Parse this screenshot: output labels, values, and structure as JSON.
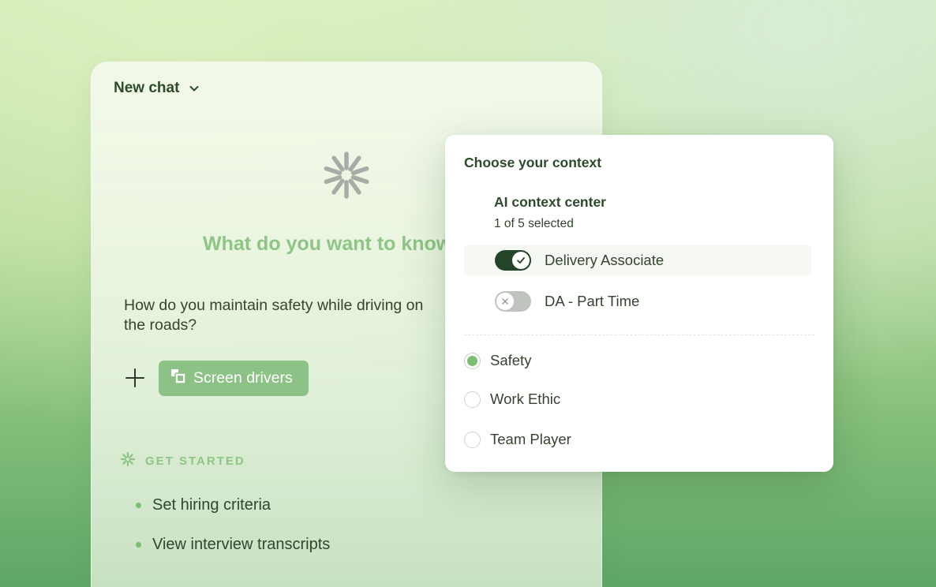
{
  "chat": {
    "title": "New chat",
    "heading": "What do you want to know",
    "question": "How do you maintain safety while driving on the roads?",
    "screen_button_label": "Screen drivers",
    "get_started_label": "GET STARTED",
    "suggestions": [
      {
        "label": "Set hiring criteria"
      },
      {
        "label": "View interview transcripts"
      }
    ]
  },
  "context": {
    "title": "Choose your context",
    "section_title": "AI context center",
    "selection_count": "1 of 5 selected",
    "toggles": [
      {
        "label": "Delivery Associate",
        "enabled": true
      },
      {
        "label": "DA - Part Time",
        "enabled": false
      }
    ],
    "options": [
      {
        "label": "Safety",
        "selected": true
      },
      {
        "label": "Work Ethic",
        "selected": false
      },
      {
        "label": "Team Player",
        "selected": false
      }
    ]
  },
  "colors": {
    "accent_green": "#8cc286",
    "dark_green": "#24442a",
    "text": "#33442f"
  },
  "icons": [
    "chevron-down-icon",
    "spinner-icon",
    "plus-icon",
    "screen-icon",
    "sparkle-icon",
    "check-icon",
    "x-icon"
  ]
}
